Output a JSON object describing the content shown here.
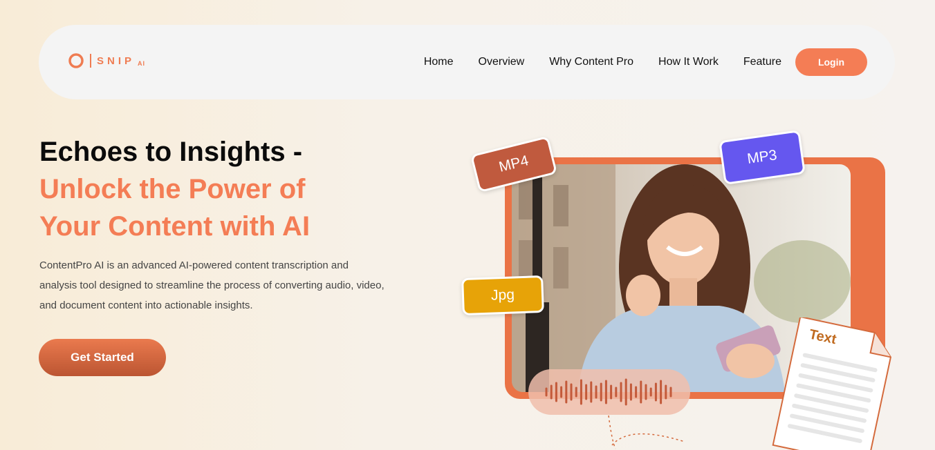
{
  "nav": {
    "logo": {
      "wordmark": "SNIP",
      "suffix": "AI"
    },
    "items": [
      {
        "label": "Home"
      },
      {
        "label": "Overview"
      },
      {
        "label": "Why Content Pro"
      },
      {
        "label": "How It Work"
      },
      {
        "label": "Feature"
      }
    ],
    "login_label": "Login"
  },
  "hero": {
    "title_line1": "Echoes to Insights -",
    "title_line2": "Unlock the Power of",
    "title_line3": "Your Content with AI",
    "description": "ContentPro AI is an advanced AI-powered content transcription and analysis tool designed to streamline the process of converting audio, video, and document content into actionable insights.",
    "cta_label": "Get Started"
  },
  "illustration": {
    "tags": {
      "mp4": "MP4",
      "mp3": "MP3",
      "jpg": "Jpg"
    },
    "doc_label": "Text"
  },
  "colors": {
    "accent": "#f47d55",
    "mp3": "#6557ef",
    "jpg": "#e7a308",
    "mp4": "#c05a3e"
  }
}
